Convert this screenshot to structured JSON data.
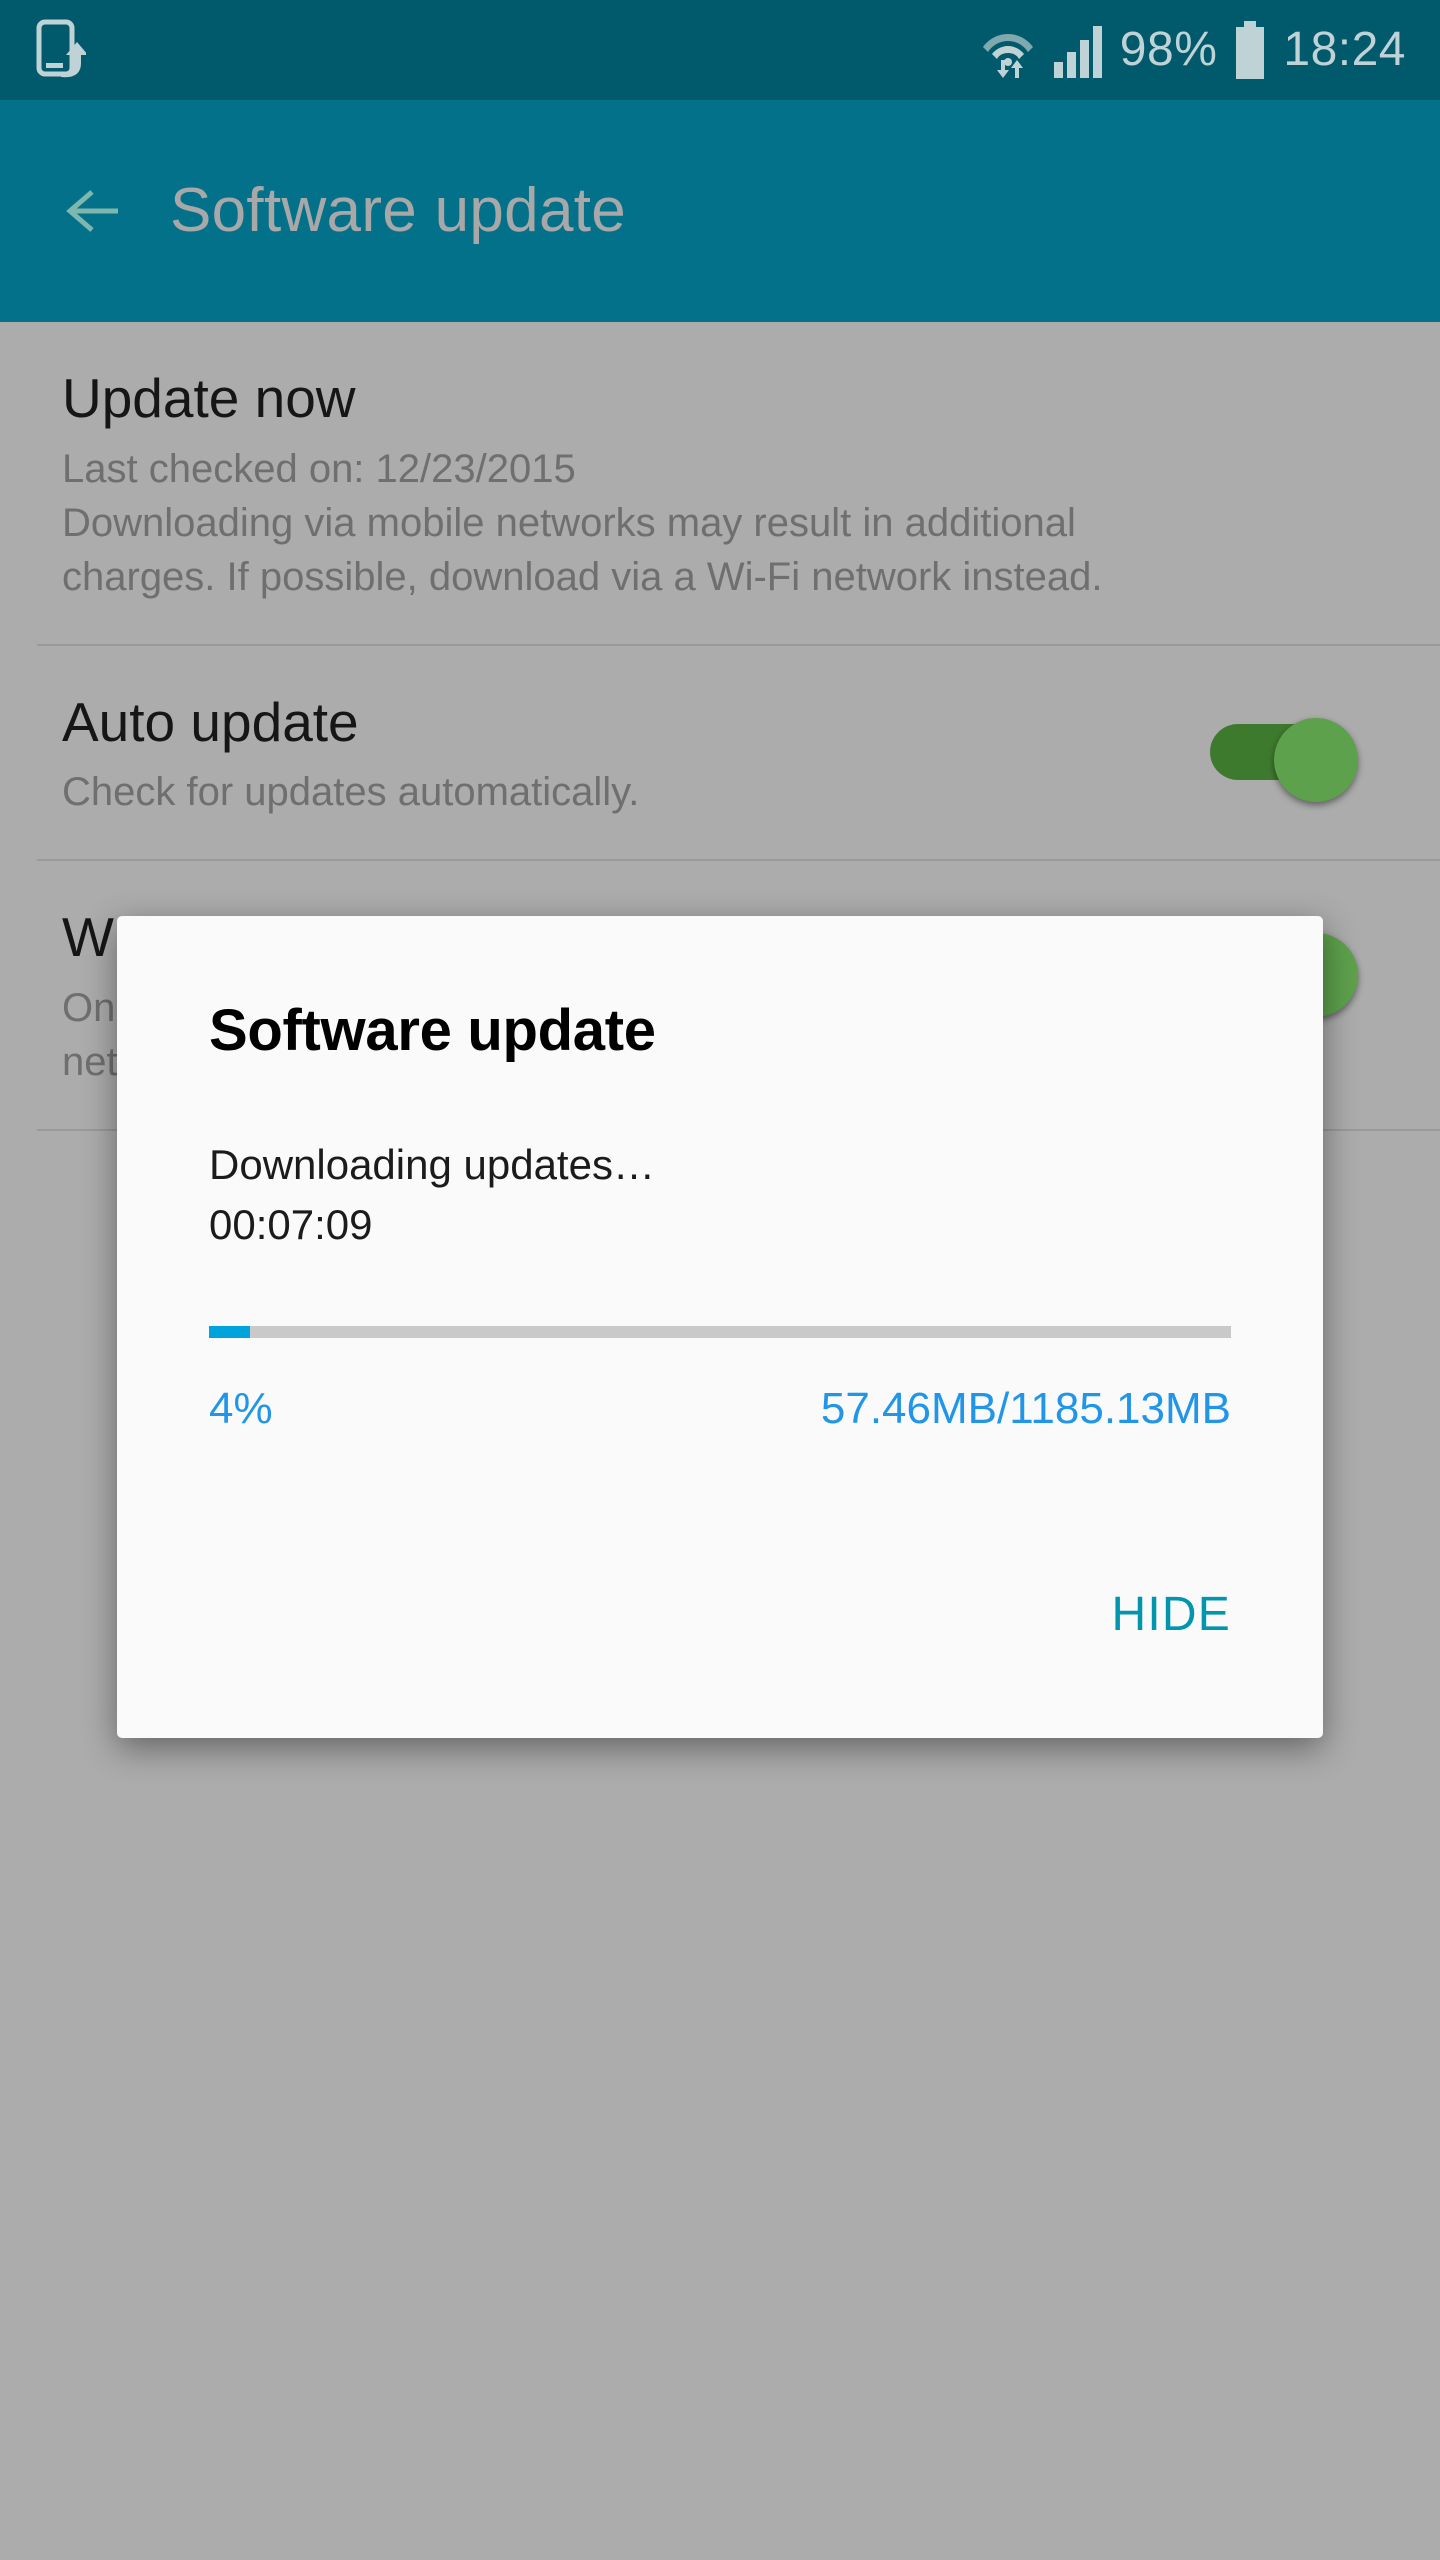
{
  "status_bar": {
    "update_icon": "phone-update-icon",
    "wifi_icon": "wifi-transfer-icon",
    "signal_icon": "signal-bars-icon",
    "battery_percent": "98%",
    "battery_icon": "battery-full-icon",
    "time": "18:24"
  },
  "app_bar": {
    "back_icon": "back-arrow-icon",
    "title": "Software update"
  },
  "preferences": [
    {
      "title": "Update now",
      "sub_lines": [
        "Last checked on: 12/23/2015",
        "Downloading via mobile networks may result in additional",
        "charges. If possible, download via a Wi-Fi network instead."
      ],
      "has_toggle": false
    },
    {
      "title": "Auto update",
      "sub_lines": [
        "Check for updates automatically."
      ],
      "has_toggle": true,
      "toggle_state": "on"
    },
    {
      "title": "W",
      "sub_lines": [
        "On",
        "net"
      ],
      "has_toggle": true,
      "toggle_state": "on"
    }
  ],
  "dialog": {
    "title": "Software update",
    "message": "Downloading updates…",
    "timer": "00:07:09",
    "progress_percent": 4,
    "percent_label": "4%",
    "size_label": "57.46MB/1185.13MB",
    "hide_button": "HIDE"
  },
  "colors": {
    "status_bar": "#015A6B",
    "app_bar": "#04718A",
    "accent_blue": "#2196E8",
    "progress_fill": "#00A3DC",
    "hide_teal": "#0295AE",
    "toggle_track": "#3E7A2E",
    "toggle_thumb": "#5EA14C",
    "dim_background": "#ACACAC"
  }
}
